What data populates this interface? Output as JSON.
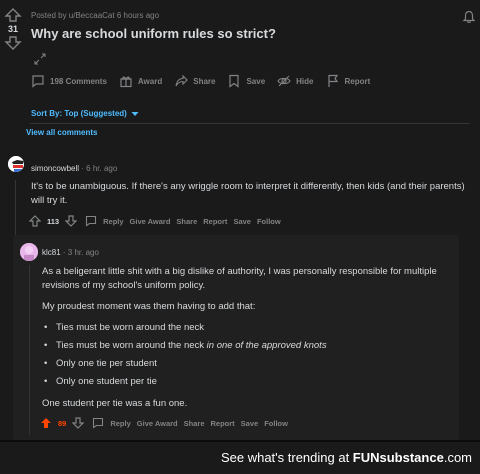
{
  "post": {
    "score": "31",
    "meta": "Posted by u/BeccaaCat 6 hours ago",
    "title": "Why are school uniform rules so strict?",
    "actions": {
      "comments": "198 Comments",
      "award": "Award",
      "share": "Share",
      "save": "Save",
      "hide": "Hide",
      "report": "Report"
    },
    "sort_label": "Sort By: Top (Suggested)",
    "view_all": "View all comments"
  },
  "comment1": {
    "user": "simoncowbell",
    "time": "· 6 hr. ago",
    "body": "It's to be unambiguous. If there's any wriggle room to interpret it differently, then kids (and their parents) will try it.",
    "score": "113",
    "actions": {
      "reply": "Reply",
      "give_award": "Give Award",
      "share": "Share",
      "report": "Report",
      "save": "Save",
      "follow": "Follow"
    }
  },
  "comment2": {
    "user": "klc81",
    "time": "· 3 hr. ago",
    "p1": "As a beligerant little shit with a big dislike of authority, I was personally responsible for multiple revisions of my school's uniform policy.",
    "p2": "My proudest moment was them having to add that:",
    "list": [
      {
        "text": "Ties must be worn around the neck",
        "italic": ""
      },
      {
        "text": "Ties must be worn around the neck ",
        "italic": "in one of the approved knots"
      },
      {
        "text": "Only one tie per student",
        "italic": ""
      },
      {
        "text": "Only one student per tie",
        "italic": ""
      }
    ],
    "p3": "One student per tie was a fun one.",
    "score": "89",
    "actions": {
      "reply": "Reply",
      "give_award": "Give Award",
      "share": "Share",
      "report": "Report",
      "save": "Save",
      "follow": "Follow"
    }
  },
  "footer": {
    "prefix": "See what's trending at ",
    "brand": "FUNsubstance",
    "suffix": ".com"
  },
  "colors": {
    "accent_blue": "#4fbcff",
    "upvote_orange": "#ff4500",
    "text": "#d7dadc",
    "muted": "#818384"
  }
}
